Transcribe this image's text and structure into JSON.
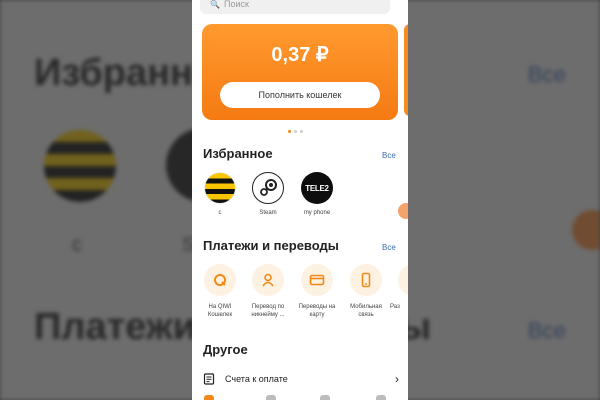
{
  "background": {
    "title_top": "Избранное",
    "title_bottom": "Платежи и переводы",
    "see_all": "Все",
    "fav_label_1": "с",
    "fav_label_2": "S"
  },
  "search": {
    "placeholder": "Поиск",
    "icon": "search-icon"
  },
  "balance": {
    "amount": "0,37 ₽",
    "topup_label": "Пополнить кошелек"
  },
  "carousel": {
    "page": 1,
    "total": 3
  },
  "favorites": {
    "title": "Избранное",
    "see_all": "Все",
    "items": [
      {
        "label": "с",
        "icon": "beeline-logo"
      },
      {
        "label": "Steam",
        "icon": "steam-logo"
      },
      {
        "label": "my phone",
        "icon": "tele2-logo",
        "logo_text": "TELE2"
      }
    ]
  },
  "payments": {
    "title": "Платежи и переводы",
    "see_all": "Все",
    "items": [
      {
        "label": "На QIWI Кошелек",
        "icon": "qiwi-icon"
      },
      {
        "label": "Перевод по никнейму ...",
        "icon": "person-icon"
      },
      {
        "label": "Переводы на карту",
        "icon": "card-icon"
      },
      {
        "label": "Мобильная связь",
        "icon": "phone-icon"
      },
      {
        "label": "Раз",
        "icon": "list-icon"
      }
    ]
  },
  "other": {
    "title": "Другое",
    "items": [
      {
        "label": "Счета к оплате",
        "icon": "document-icon"
      }
    ]
  },
  "colors": {
    "accent": "#f57a12",
    "link": "#3b6db3",
    "icon_bg": "#fdf1e2"
  }
}
